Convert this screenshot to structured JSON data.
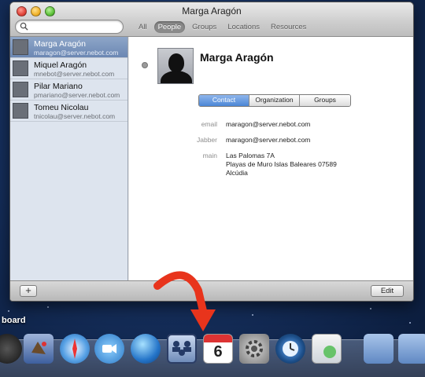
{
  "window": {
    "title": "Marga Aragón"
  },
  "search": {
    "value": "",
    "placeholder": ""
  },
  "nav_tabs": [
    {
      "label": "All",
      "active": false
    },
    {
      "label": "People",
      "active": true
    },
    {
      "label": "Groups",
      "active": false
    },
    {
      "label": "Locations",
      "active": false
    },
    {
      "label": "Resources",
      "active": false
    }
  ],
  "people": [
    {
      "name": "Marga Aragón",
      "email": "maragon@server.nebot.com",
      "selected": true
    },
    {
      "name": "Miquel Aragón",
      "email": "mnebot@server.nebot.com",
      "selected": false
    },
    {
      "name": "Pilar Mariano",
      "email": "pmariano@server.nebot.com",
      "selected": false
    },
    {
      "name": "Tomeu Nicolau",
      "email": "tnicolau@server.nebot.com",
      "selected": false
    }
  ],
  "detail": {
    "name": "Marga Aragón",
    "segments": [
      {
        "label": "Contact",
        "active": true
      },
      {
        "label": "Organization",
        "active": false
      },
      {
        "label": "Groups",
        "active": false
      }
    ],
    "fields": {
      "email_label": "email",
      "email_value": "maragon@server.nebot.com",
      "jabber_label": "Jabber",
      "jabber_value": "maragon@server.nebot.com",
      "main_label": "main",
      "address_line1": "Las Palomas 7A",
      "address_line2": "Playas de Muro Islas Baleares 07589",
      "address_line3": "Alcúdia"
    }
  },
  "bottom_bar": {
    "add_label": "+",
    "edit_label": "Edit"
  },
  "dock": {
    "partial_label": "board",
    "calendar_day": "6",
    "icons": [
      "dashboard-icon",
      "mail-icon",
      "safari-icon",
      "ichat-icon",
      "network-globe-icon",
      "directory-icon",
      "ical-icon",
      "system-preferences-icon",
      "time-machine-icon",
      "preview-icon",
      "applications-folder-icon",
      "documents-folder-icon"
    ]
  },
  "colors": {
    "selection": "#6b87b3",
    "segment_active": "#4b86d6",
    "arrow": "#e8341c",
    "desktop": "#16305e"
  }
}
